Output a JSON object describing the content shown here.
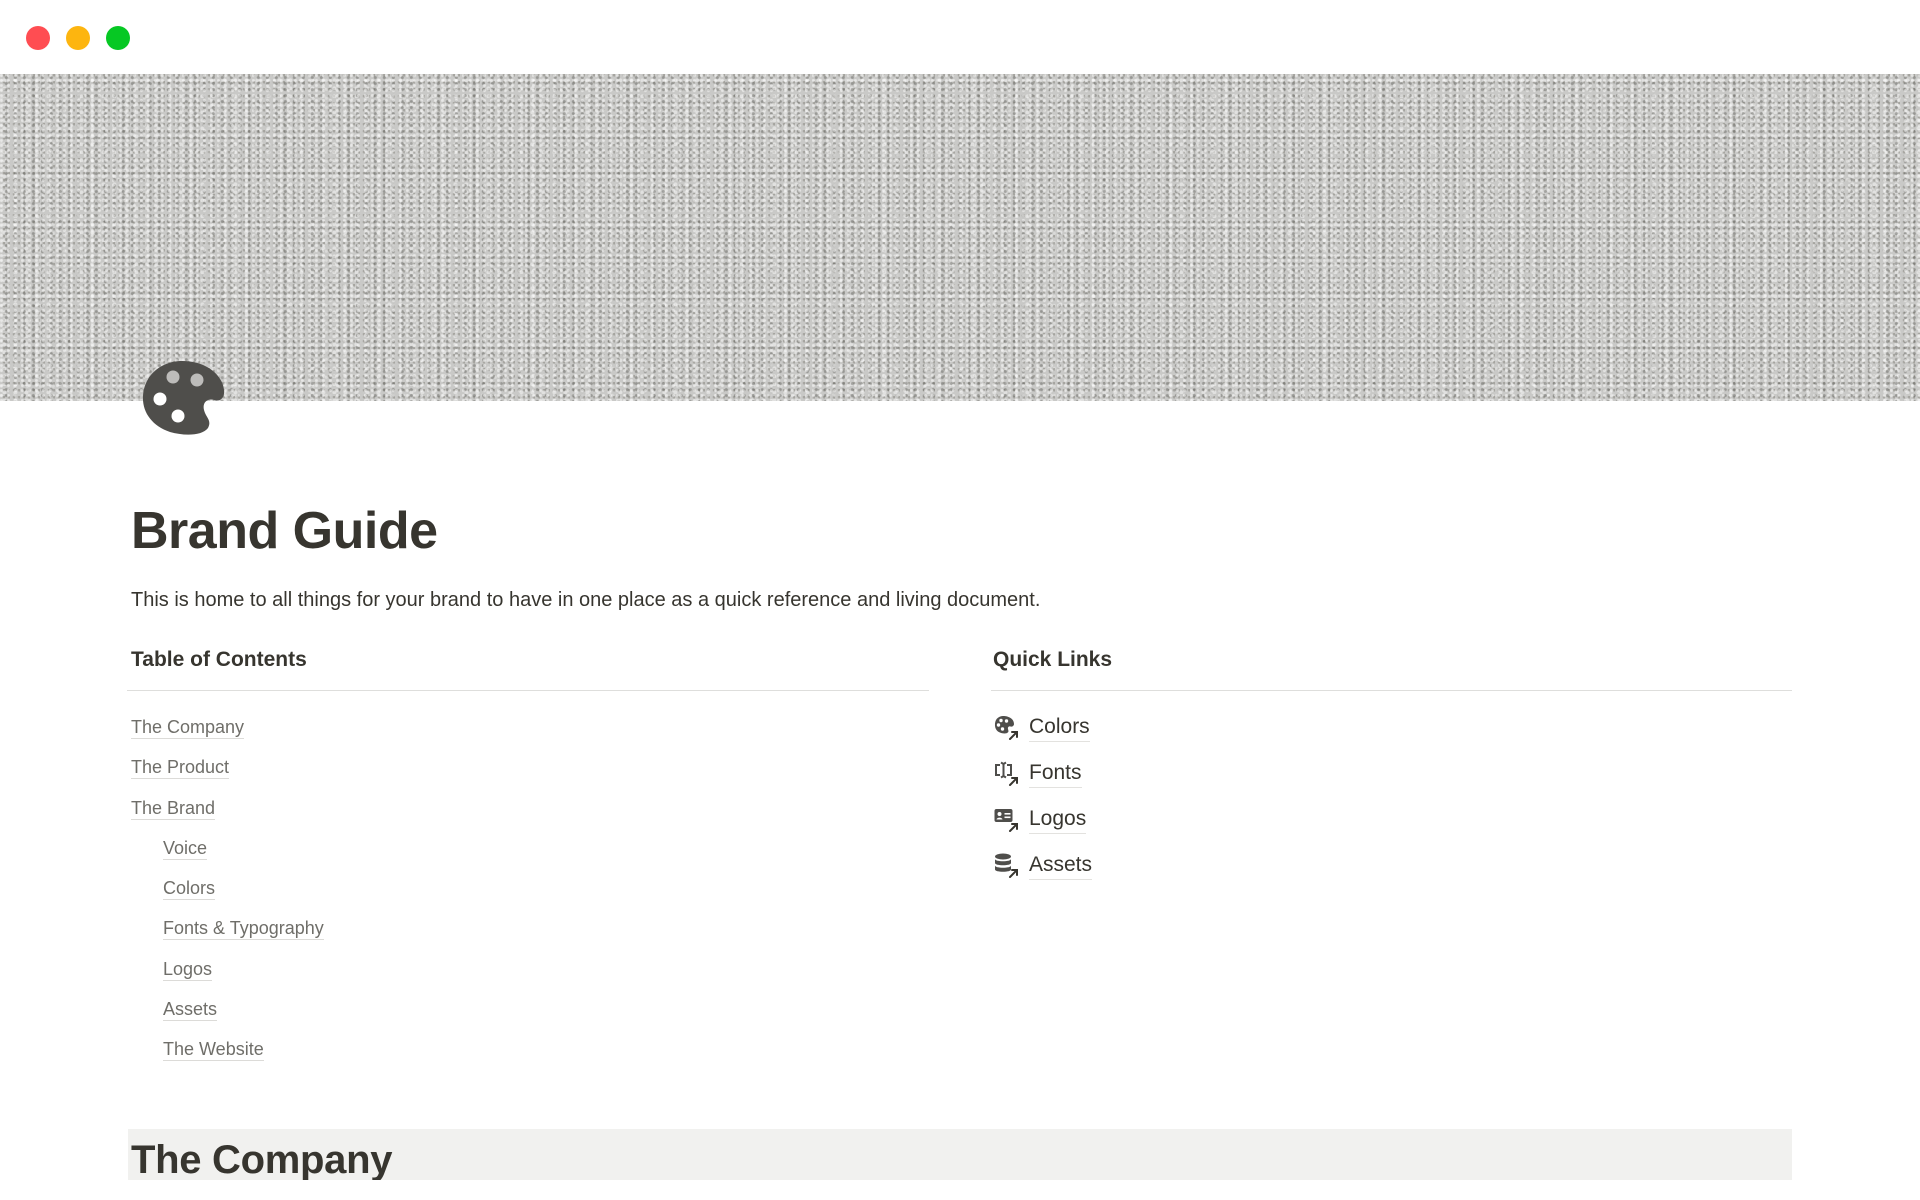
{
  "window": {
    "controls": [
      "close",
      "minimize",
      "maximize"
    ],
    "colors": {
      "close": "#ff4d52",
      "minimize": "#fdb50f",
      "maximize": "#06c823"
    }
  },
  "cover": {
    "description": "gray textured stucco wall"
  },
  "page": {
    "icon": "palette-icon",
    "title": "Brand Guide",
    "description": "This is home to all things for your brand to have in one place as a quick reference and living document."
  },
  "table_of_contents": {
    "heading": "Table of Contents",
    "items": [
      {
        "label": "The Company",
        "level": 0
      },
      {
        "label": "The Product",
        "level": 0
      },
      {
        "label": "The Brand",
        "level": 0
      },
      {
        "label": "Voice",
        "level": 1
      },
      {
        "label": "Colors",
        "level": 1
      },
      {
        "label": "Fonts & Typography",
        "level": 1
      },
      {
        "label": "Logos",
        "level": 1
      },
      {
        "label": "Assets",
        "level": 1
      },
      {
        "label": "The Website",
        "level": 1
      }
    ]
  },
  "quick_links": {
    "heading": "Quick Links",
    "items": [
      {
        "label": "Colors",
        "icon": "palette-link-icon"
      },
      {
        "label": "Fonts",
        "icon": "text-cursor-link-icon"
      },
      {
        "label": "Logos",
        "icon": "id-card-link-icon"
      },
      {
        "label": "Assets",
        "icon": "database-link-icon"
      }
    ]
  },
  "sections": [
    {
      "heading": "The Company"
    }
  ],
  "colors": {
    "text": "#37352f",
    "muted_text": "#6f6e69",
    "divider": "#dededc",
    "heading_highlight": "#f1f1ef"
  }
}
